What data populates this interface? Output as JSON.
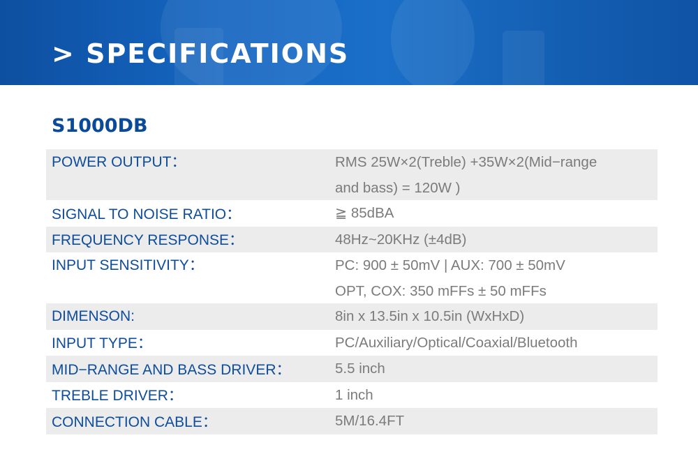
{
  "banner": {
    "title": "> SPECIFICATIONS"
  },
  "model": "S1000DB",
  "specs": [
    {
      "label": "POWER OUTPUT：",
      "value_lines": [
        "RMS 25W×2(Treble) +35W×2(Mid−range",
        "and bass) = 120W )"
      ]
    },
    {
      "label": "SIGNAL TO NOISE RATIO：",
      "value_lines": [
        "≧ 85dBA"
      ]
    },
    {
      "label": "FREQUENCY RESPONSE：",
      "value_lines": [
        "48Hz~20KHz (±4dB)"
      ]
    },
    {
      "label": "INPUT SENSITIVITY：",
      "value_lines": [
        "PC: 900 ± 50mV | AUX: 700 ± 50mV",
        "OPT, COX: 350 mFFs ± 50 mFFs"
      ]
    },
    {
      "label": "DIMENSON:",
      "value_lines": [
        "8in x 13.5in x 10.5in (WxHxD)"
      ]
    },
    {
      "label": "INPUT TYPE：",
      "value_lines": [
        "PC/Auxiliary/Optical/Coaxial/Bluetooth"
      ]
    },
    {
      "label": "MID−RANGE AND BASS DRIVER：",
      "value_lines": [
        "5.5 inch"
      ]
    },
    {
      "label": "TREBLE DRIVER：",
      "value_lines": [
        "1 inch"
      ]
    },
    {
      "label": "CONNECTION CABLE：",
      "value_lines": [
        "5M/16.4FT"
      ]
    }
  ],
  "colors": {
    "banner_blue": "#1565c0",
    "label_blue": "#0e4c9c",
    "value_gray": "#7b7b7b",
    "row_shade": "#ececec"
  }
}
